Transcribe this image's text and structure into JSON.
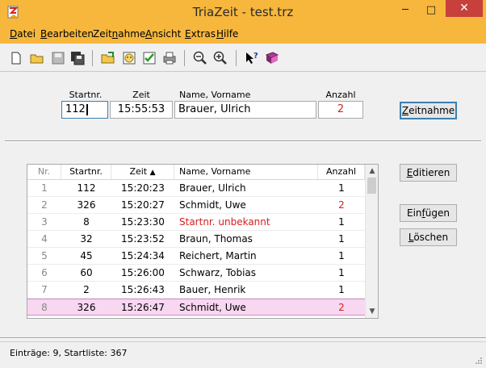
{
  "window": {
    "title": "TriaZeit  -  test.trz",
    "minimize": "─",
    "maximize": "□",
    "close": "✕"
  },
  "menu": [
    {
      "label": "Datei",
      "mnemonic": "D"
    },
    {
      "label": "Bearbeiten",
      "mnemonic": "B"
    },
    {
      "label": "Zeitnahme",
      "mnemonic": "n"
    },
    {
      "label": "Ansicht",
      "mnemonic": "A"
    },
    {
      "label": "Extras",
      "mnemonic": "E"
    },
    {
      "label": "Hilfe",
      "mnemonic": "H"
    }
  ],
  "toolbar_icons": [
    "new-file-icon",
    "open-folder-icon",
    "save-disk-icon",
    "save-all-icon",
    "open-list-icon",
    "person-icon",
    "checklist-icon",
    "print-icon",
    "zoom-out-icon",
    "zoom-in-icon",
    "help-pointer-icon",
    "book-icon"
  ],
  "entry": {
    "startnr_label": "Startnr.",
    "zeit_label": "Zeit",
    "name_label": "Name, Vorname",
    "anzahl_label": "Anzahl",
    "startnr": "112",
    "zeit": "15:55:53",
    "name": "Brauer, Ulrich",
    "anzahl": "2",
    "zeitnahme_button": "Zeitnahme"
  },
  "table": {
    "headers": {
      "nr": "Nr.",
      "startnr": "Startnr.",
      "zeit": "Zeit",
      "sort_glyph": "▲",
      "name": "Name, Vorname",
      "anzahl": "Anzahl"
    },
    "rows": [
      {
        "nr": "1",
        "startnr": "112",
        "zeit": "15:20:23",
        "name": "Brauer, Ulrich",
        "anzahl": "1"
      },
      {
        "nr": "2",
        "startnr": "326",
        "zeit": "15:20:27",
        "name": "Schmidt, Uwe",
        "anzahl": "2"
      },
      {
        "nr": "3",
        "startnr": "8",
        "zeit": "15:23:30",
        "name": "Startnr. unbekannt",
        "anzahl": "1"
      },
      {
        "nr": "4",
        "startnr": "32",
        "zeit": "15:23:52",
        "name": "Braun, Thomas",
        "anzahl": "1"
      },
      {
        "nr": "5",
        "startnr": "45",
        "zeit": "15:24:34",
        "name": "Reichert, Martin",
        "anzahl": "1"
      },
      {
        "nr": "6",
        "startnr": "60",
        "zeit": "15:26:00",
        "name": "Schwarz, Tobias",
        "anzahl": "1"
      },
      {
        "nr": "7",
        "startnr": "2",
        "zeit": "15:26:43",
        "name": "Bauer, Henrik",
        "anzahl": "1"
      },
      {
        "nr": "8",
        "startnr": "326",
        "zeit": "15:26:47",
        "name": "Schmidt, Uwe",
        "anzahl": "2"
      }
    ]
  },
  "buttons": {
    "editieren": "Editieren",
    "einfuegen": "Einfügen",
    "loeschen": "Löschen"
  },
  "status": "Einträge:  9,   Startliste:  367",
  "colors": {
    "accent_bar": "#f6b73c",
    "warning_red": "#d42020",
    "selected_row": "#f8d7f1"
  }
}
